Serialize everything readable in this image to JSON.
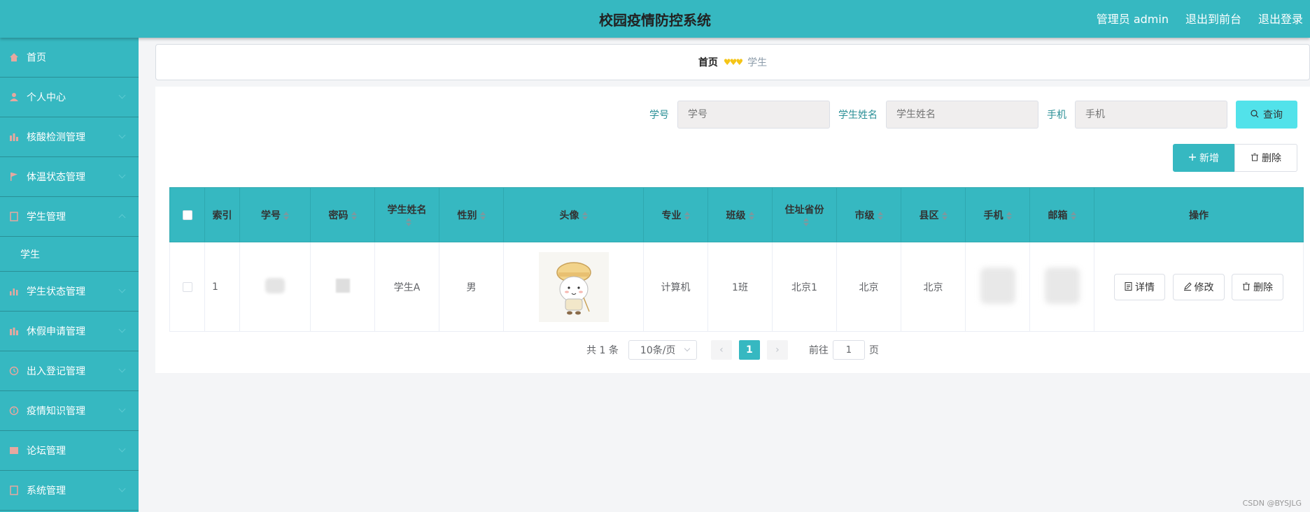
{
  "header": {
    "title": "校园疫情防控系统",
    "admin": "管理员 admin",
    "to_front": "退出到前台",
    "logout": "退出登录"
  },
  "sidebar": {
    "items": [
      {
        "label": "首页",
        "icon": "home-icon"
      },
      {
        "label": "个人中心",
        "icon": "user-icon"
      },
      {
        "label": "核酸检测管理",
        "icon": "chart-icon"
      },
      {
        "label": "体温状态管理",
        "icon": "flag-icon"
      },
      {
        "label": "学生管理",
        "icon": "document-icon"
      },
      {
        "label": "学生",
        "icon": ""
      },
      {
        "label": "学生状态管理",
        "icon": "bar-chart-icon"
      },
      {
        "label": "休假申请管理",
        "icon": "chart-icon"
      },
      {
        "label": "出入登记管理",
        "icon": "clock-icon"
      },
      {
        "label": "疫情知识管理",
        "icon": "info-icon"
      },
      {
        "label": "论坛管理",
        "icon": "grid-icon"
      },
      {
        "label": "系统管理",
        "icon": "document-icon"
      }
    ]
  },
  "breadcrumb": {
    "home": "首页",
    "separator": "♥♥♥",
    "current": "学生"
  },
  "search": {
    "label_id": "学号",
    "placeholder_id": "学号",
    "label_name": "学生姓名",
    "placeholder_name": "学生姓名",
    "label_phone": "手机",
    "placeholder_phone": "手机",
    "button": "查询"
  },
  "actions": {
    "add": "新增",
    "delete": "删除"
  },
  "table": {
    "headers": [
      "索引",
      "学号",
      "密码",
      "学生姓名",
      "性别",
      "头像",
      "专业",
      "班级",
      "住址省份",
      "市级",
      "县区",
      "手机",
      "邮箱",
      "操作"
    ],
    "row": {
      "index": "1",
      "name": "学生A",
      "gender": "男",
      "major": "计算机",
      "class": "1班",
      "province": "北京1",
      "city": "北京",
      "county": "北京"
    },
    "ops": {
      "detail": "详情",
      "edit": "修改",
      "delete": "删除"
    }
  },
  "pager": {
    "total": "共 1 条",
    "size": "10条/页",
    "page": "1",
    "goto": "前往",
    "goto_value": "1",
    "page_unit": "页"
  },
  "watermark": "CSDN @BYSJLG",
  "colors": {
    "primary": "#36b8c1",
    "search_button": "#52e2ea"
  }
}
